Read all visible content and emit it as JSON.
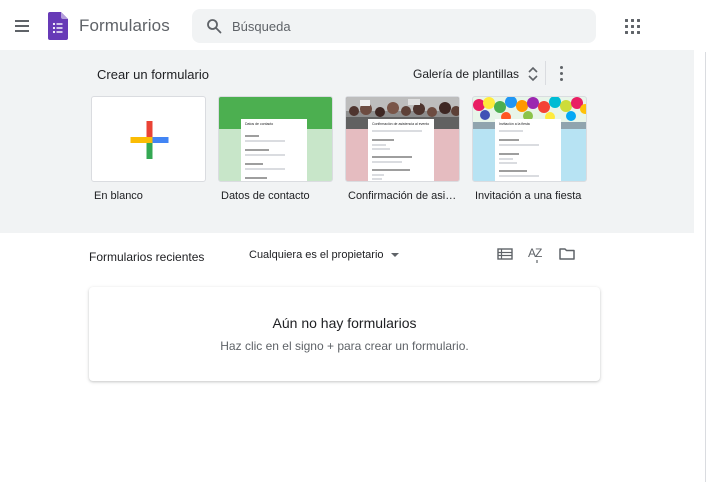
{
  "header": {
    "app_title": "Formularios",
    "search_placeholder": "Búsqueda"
  },
  "templates": {
    "title": "Crear un formulario",
    "gallery_label": "Galería de plantillas",
    "items": [
      {
        "label": "En blanco"
      },
      {
        "label": "Datos de contacto",
        "form_title": "Datos de contacto"
      },
      {
        "label": "Confirmación de asistencia al evento",
        "form_title": "Confirmación de asistencia al evento"
      },
      {
        "label": "Invitación a una fiesta",
        "form_title": "Invitación a la fiesta"
      }
    ]
  },
  "recent": {
    "title": "Formularios recientes",
    "owner_filter": "Cualquiera es el propietario",
    "sort_label": "AZ",
    "empty_title": "Aún no hay formularios",
    "empty_subtitle": "Haz clic en el signo + para crear un formulario."
  },
  "colors": {
    "forms_purple": "#673ab7",
    "contact_green": "#4caf50",
    "rsvp_pink": "#e5bcc0",
    "party_blue": "#b7e3f3"
  }
}
